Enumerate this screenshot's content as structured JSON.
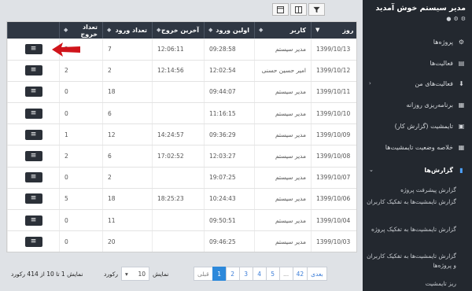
{
  "toolbar": {
    "buttons": [
      {
        "icon": "columns-icon"
      },
      {
        "icon": "grid-icon"
      },
      {
        "icon": "filter-icon"
      }
    ]
  },
  "table": {
    "headers": {
      "day": "روز",
      "user": "کاربر",
      "first_login": "اولین ورود",
      "last_exit": "آخرین خروج",
      "login_count": "تعداد ورود",
      "exit_count": "تعداد خروج"
    },
    "rows": [
      {
        "day": "1399/10/13",
        "user": "مدیر سیستم",
        "first_login": "09:28:58",
        "last_exit": "12:06:11",
        "login_count": "7",
        "exit_count": "2"
      },
      {
        "day": "1399/10/12",
        "user": "امیر حسین حسنی",
        "first_login": "12:02:54",
        "last_exit": "12:14:56",
        "login_count": "2",
        "exit_count": "2"
      },
      {
        "day": "1399/10/11",
        "user": "مدیر سیستم",
        "first_login": "09:44:07",
        "last_exit": "",
        "login_count": "18",
        "exit_count": "0"
      },
      {
        "day": "1399/10/10",
        "user": "مدیر سیستم",
        "first_login": "11:16:15",
        "last_exit": "",
        "login_count": "6",
        "exit_count": "0"
      },
      {
        "day": "1399/10/09",
        "user": "مدیر سیستم",
        "first_login": "09:36:29",
        "last_exit": "14:24:57",
        "login_count": "12",
        "exit_count": "1"
      },
      {
        "day": "1399/10/08",
        "user": "مدیر سیستم",
        "first_login": "12:03:27",
        "last_exit": "17:02:52",
        "login_count": "6",
        "exit_count": "2"
      },
      {
        "day": "1399/10/07",
        "user": "مدیر سیستم",
        "first_login": "19:07:25",
        "last_exit": "",
        "login_count": "2",
        "exit_count": "0"
      },
      {
        "day": "1399/10/06",
        "user": "مدیر سیستم",
        "first_login": "10:24:43",
        "last_exit": "18:25:23",
        "login_count": "18",
        "exit_count": "5"
      },
      {
        "day": "1399/10/04",
        "user": "مدیر سیستم",
        "first_login": "09:50:51",
        "last_exit": "",
        "login_count": "11",
        "exit_count": "0"
      },
      {
        "day": "1399/10/03",
        "user": "مدیر سیستم",
        "first_login": "09:46:25",
        "last_exit": "",
        "login_count": "20",
        "exit_count": "0"
      }
    ]
  },
  "pagination": {
    "prev": "قبلی",
    "pages": [
      "1",
      "2",
      "3",
      "4",
      "5",
      "...",
      "42"
    ],
    "active": "1",
    "next": "بعدی"
  },
  "page_size": {
    "label_before": "نمایش",
    "value": "10",
    "label_after": "رکورد"
  },
  "info_text": "نمایش 1 تا 10 از 414 رکورد",
  "sidebar": {
    "title": "مدیر سیستم خوش آمدید",
    "items": [
      {
        "label": "پروژه‌ها",
        "icon": "projects-icon",
        "glyph": "⚙"
      },
      {
        "label": "فعالیت‌ها",
        "icon": "activities-icon",
        "glyph": "▤"
      },
      {
        "label": "فعالیت‌های من",
        "icon": "download-icon",
        "glyph": "⬇"
      },
      {
        "label": "برنامه‌ریزی روزانه",
        "icon": "calendar-grid-icon",
        "glyph": "▦"
      },
      {
        "label": "تایمشیت (گزارش کار)",
        "icon": "calendar-icon",
        "glyph": "▣"
      },
      {
        "label": "خلاصه وضعیت تایمشیت‌ها",
        "icon": "table-icon",
        "glyph": "▦"
      },
      {
        "label": "گزارش‌ها",
        "icon": "file-icon",
        "glyph": "▮"
      }
    ],
    "subitems": [
      "گزارش پیشرفت پروژه",
      "گزارش تایمشیت‌ها به تفکیک کاربران",
      "گزارش تایمشیت‌ها به تفکیک پروژه",
      "گزارش تایمشیت‌ها به تفکیک کاربران و پروژه‌ها",
      "ریز تایمشیت"
    ]
  },
  "colors": {
    "sidebar_bg": "#23282f",
    "table_header_bg": "#2f3743",
    "accent": "#2d89db",
    "arrow": "#d0141b"
  }
}
